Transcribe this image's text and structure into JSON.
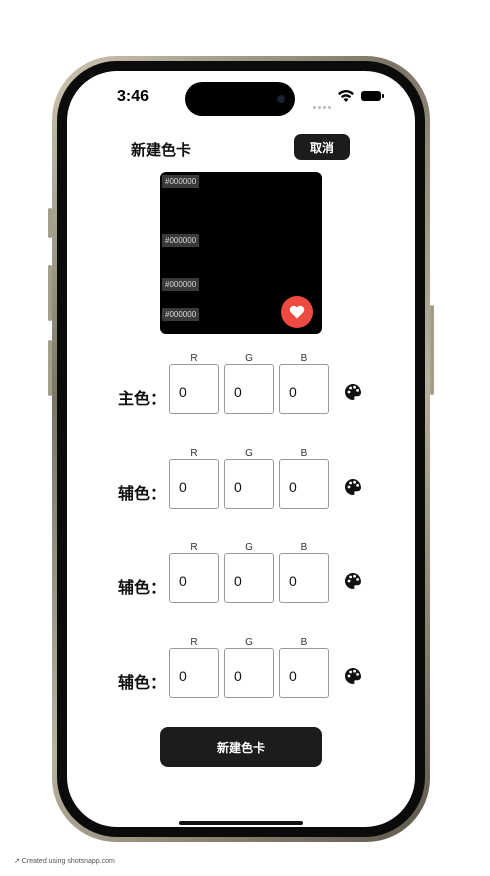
{
  "status_bar": {
    "time": "3:46"
  },
  "header": {
    "title": "新建色卡",
    "cancel_label": "取消"
  },
  "preview": {
    "background": "#000000",
    "hex_labels": [
      "#000000",
      "#000000",
      "#000000",
      "#000000"
    ],
    "favorite_color": "#ee4a3f"
  },
  "channel_headers": [
    "R",
    "G",
    "B"
  ],
  "rows": [
    {
      "label": "主色：",
      "r": "0",
      "g": "0",
      "b": "0"
    },
    {
      "label": "辅色：",
      "r": "0",
      "g": "0",
      "b": "0"
    },
    {
      "label": "辅色：",
      "r": "0",
      "g": "0",
      "b": "0"
    },
    {
      "label": "辅色：",
      "r": "0",
      "g": "0",
      "b": "0"
    }
  ],
  "create_label": "新建色卡",
  "footer": "↗ Created using shotsnapp.com"
}
